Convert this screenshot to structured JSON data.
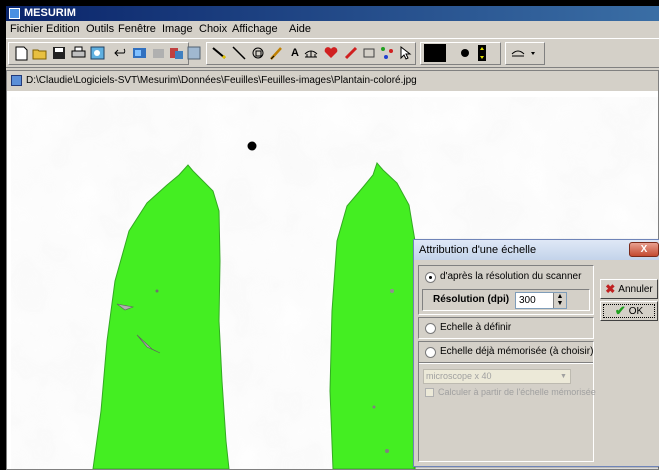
{
  "app": {
    "title": "MESURIM"
  },
  "menu": [
    "Fichier",
    "Edition",
    "Outils",
    "Fenêtre",
    "Image",
    "Choix",
    "Affichage",
    "Aide"
  ],
  "toolbar": {
    "icons": [
      "new-icon",
      "open-icon",
      "save-icon",
      "print-icon",
      "preview-icon",
      "undo-icon",
      "image-icon",
      "copy-icon",
      "paste-icon",
      "grid-icon",
      "line-icon",
      "segment-icon",
      "polygon-icon",
      "pen-icon",
      "text-icon",
      "scale-icon",
      "heart-icon",
      "pencil-icon",
      "rectangle-icon",
      "points-icon",
      "pointer-icon",
      "color-swatch-icon",
      "dot-size-icon",
      "stepper-icon",
      "scale-dropdown-icon"
    ],
    "text_tool_label": "A"
  },
  "document": {
    "path": "D:\\Claudie\\Logiciels-SVT\\Mesurim\\Données\\Feuilles\\Feuilles-images\\Plantain-coloré.jpg"
  },
  "colors": {
    "leaf": "#44ee22",
    "title_gradient_start": "#0a246a",
    "dialog_title": "#c3d3ea"
  },
  "dialog": {
    "title": "Attribution d'une échelle",
    "close_label": "X",
    "option_scanner": "d'après la résolution du scanner",
    "resolution_label": "Résolution (dpi)",
    "resolution_value": "300",
    "option_define": "Echelle à définir",
    "option_memorized": "Echelle déjà mémorisée (à choisir)",
    "memorized_select_value": "microscope x 40",
    "calc_checkbox_label": "Calculer à partir de l'échelle mémorisée",
    "cancel_label": "Annuler",
    "ok_label": "OK"
  }
}
